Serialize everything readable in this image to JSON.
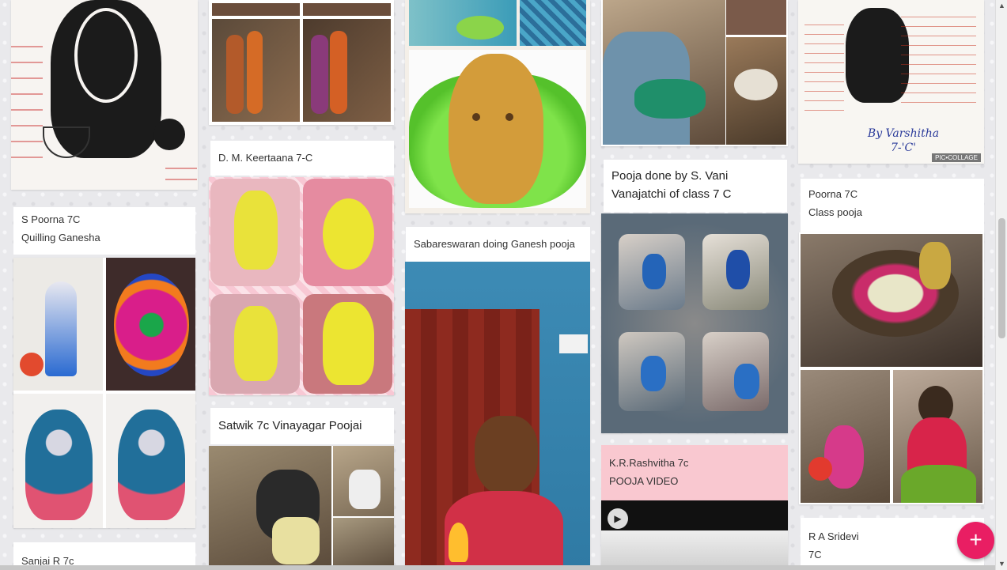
{
  "captions": {
    "col1": {
      "poorna_name": "S Poorna 7C",
      "poorna_sub": "Quilling Ganesha",
      "sanjai": "Sanjai  R 7c"
    },
    "col2": {
      "keertaana": "D. M. Keertaana 7-C",
      "satwik": "Satwik 7c Vinayagar Poojai"
    },
    "col3": {
      "sabareswaran": "Sabareswaran doing Ganesh pooja"
    },
    "col4": {
      "vani": "Pooja done by S. Vani Vanajatchi of class 7 C",
      "rashvitha_name": "K.R.Rashvitha 7c",
      "rashvitha_sub": "POOJA VIDEO"
    },
    "col5": {
      "varshitha_1": "By Varshitha",
      "varshitha_2": "7-'C'",
      "collage_tag": "PIC•COLLAGE",
      "poorna_name": "Poorna 7C",
      "poorna_sub": "Class pooja",
      "sridevi_name": "R A Sridevi",
      "sridevi_sub": "7C"
    }
  },
  "fab_label": "+",
  "icons": {
    "play": "play-icon",
    "add": "add-icon"
  },
  "colors": {
    "fab": "#e91e63",
    "pink_caption": "#f9c8d0"
  }
}
